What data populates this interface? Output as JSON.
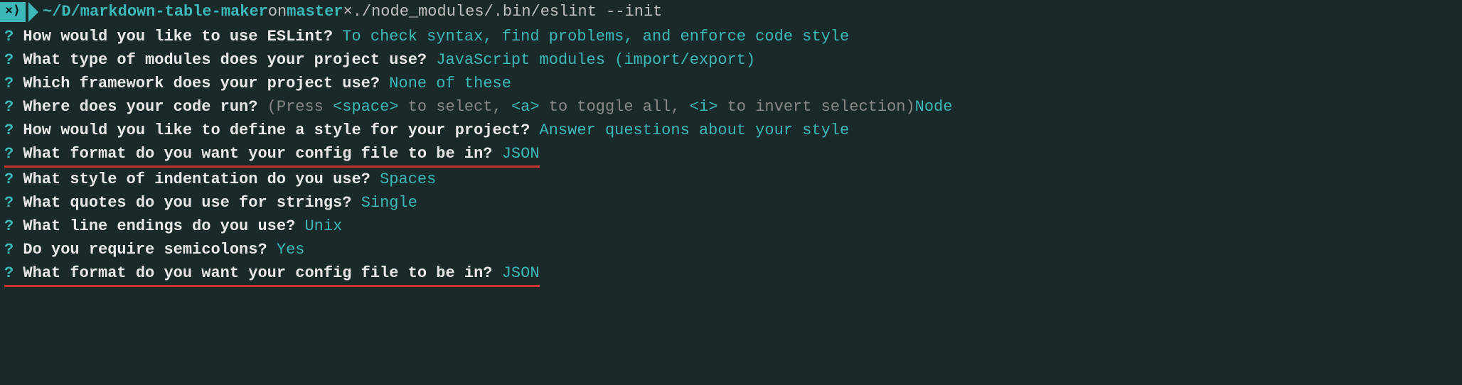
{
  "prompt": {
    "shell_icon": "⨯⟩",
    "path": "~/D/markdown-table-maker",
    "on": " on ",
    "branch": "master",
    "branch_mark": " ×  ",
    "command": "./node_modules/.bin/eslint --init"
  },
  "lines": [
    {
      "qmark": "?",
      "question": " How would you like to use ESLint? ",
      "answer": "To check syntax, find problems, and enforce code style",
      "underlined": false
    },
    {
      "qmark": "?",
      "question": " What type of modules does your project use? ",
      "answer": "JavaScript modules (import/export)",
      "underlined": false
    },
    {
      "qmark": "?",
      "question": " Which framework does your project use? ",
      "answer": "None of these",
      "underlined": false
    },
    {
      "qmark": "?",
      "question": " Where does your code run? ",
      "hint_prefix": "(Press ",
      "hint_key1": "<space>",
      "hint_mid1": " to select, ",
      "hint_key2": "<a>",
      "hint_mid2": " to toggle all, ",
      "hint_key3": "<i>",
      "hint_suffix": " to invert selection)",
      "node": "Node",
      "underlined": false,
      "has_hint": true
    },
    {
      "qmark": "?",
      "question": " How would you like to define a style for your project? ",
      "answer": "Answer questions about your style",
      "underlined": false
    },
    {
      "qmark": "?",
      "question": " What format do you want your config file to be in? ",
      "answer": "JSON",
      "underlined": true
    },
    {
      "qmark": "?",
      "question": " What style of indentation do you use? ",
      "answer": "Spaces",
      "underlined": false
    },
    {
      "qmark": "?",
      "question": " What quotes do you use for strings? ",
      "answer": "Single",
      "underlined": false
    },
    {
      "qmark": "?",
      "question": " What line endings do you use? ",
      "answer": "Unix",
      "underlined": false
    },
    {
      "qmark": "?",
      "question": " Do you require semicolons? ",
      "answer": "Yes",
      "underlined": false
    },
    {
      "qmark": "?",
      "question": " What format do you want your config file to be in? ",
      "answer": "JSON",
      "underlined": true
    }
  ]
}
